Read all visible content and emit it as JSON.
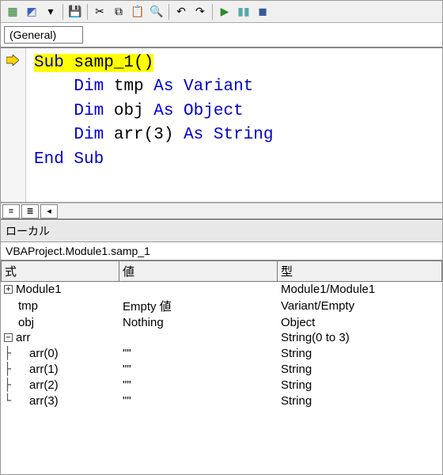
{
  "toolbar": {
    "icons": [
      "excel",
      "vbe",
      "dropdown-arrow",
      "save",
      "cut",
      "copy",
      "paste",
      "find",
      "replace",
      "undo",
      "redo",
      "run",
      "pause",
      "stop"
    ]
  },
  "dropdown": {
    "value": "(General)"
  },
  "code": {
    "lines": [
      {
        "tokens": [
          {
            "t": "Sub",
            "c": "kw",
            "hl": true
          },
          {
            "t": " samp_1()",
            "c": "",
            "hl": true
          }
        ]
      },
      {
        "tokens": [
          {
            "t": "    ",
            "c": ""
          },
          {
            "t": "Dim",
            "c": "kw"
          },
          {
            "t": " tmp ",
            "c": ""
          },
          {
            "t": "As Variant",
            "c": "kw"
          }
        ]
      },
      {
        "tokens": [
          {
            "t": "    ",
            "c": ""
          },
          {
            "t": "Dim",
            "c": "kw"
          },
          {
            "t": " obj ",
            "c": ""
          },
          {
            "t": "As Object",
            "c": "kw"
          }
        ]
      },
      {
        "tokens": [
          {
            "t": "    ",
            "c": ""
          },
          {
            "t": "Dim",
            "c": "kw"
          },
          {
            "t": " arr(3) ",
            "c": ""
          },
          {
            "t": "As String",
            "c": "kw"
          }
        ]
      },
      {
        "tokens": [
          {
            "t": "End Sub",
            "c": "kw"
          }
        ]
      }
    ]
  },
  "locals_title": "ローカル",
  "context": "VBAProject.Module1.samp_1",
  "headers": {
    "expr": "式",
    "value": "値",
    "type": "型"
  },
  "rows": [
    {
      "toggle": "+",
      "indent": 0,
      "expr": "Module1",
      "value": "",
      "type": "Module1/Module1"
    },
    {
      "toggle": "",
      "indent": 1,
      "expr": "tmp",
      "value": "Empty 値",
      "type": "Variant/Empty"
    },
    {
      "toggle": "",
      "indent": 1,
      "expr": "obj",
      "value": "Nothing",
      "type": "Object"
    },
    {
      "toggle": "-",
      "indent": 0,
      "expr": "arr",
      "value": "",
      "type": "String(0 to 3)"
    },
    {
      "toggle": "",
      "indent": 2,
      "tree": "├",
      "expr": "arr(0)",
      "value": "\"\"",
      "type": "String"
    },
    {
      "toggle": "",
      "indent": 2,
      "tree": "├",
      "expr": "arr(1)",
      "value": "\"\"",
      "type": "String"
    },
    {
      "toggle": "",
      "indent": 2,
      "tree": "├",
      "expr": "arr(2)",
      "value": "\"\"",
      "type": "String"
    },
    {
      "toggle": "",
      "indent": 2,
      "tree": "└",
      "expr": "arr(3)",
      "value": "\"\"",
      "type": "String"
    }
  ]
}
